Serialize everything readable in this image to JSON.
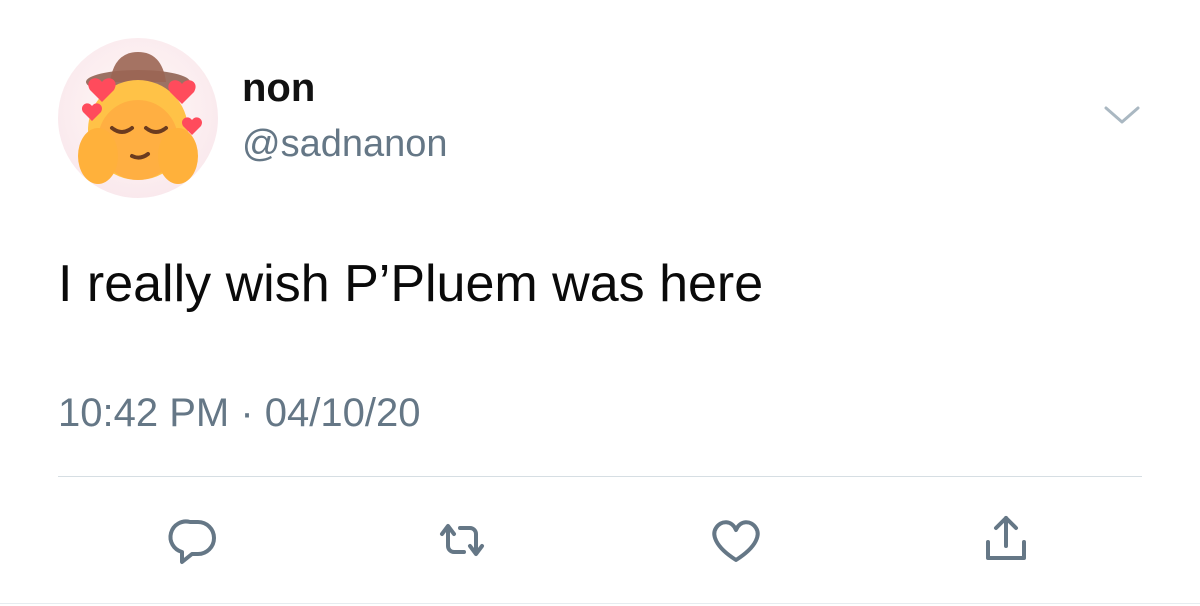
{
  "tweet": {
    "display_name": "non",
    "username": "@sadnanon",
    "text": "I really wish P’Pluem was here",
    "timestamp": "10:42 PM · 04/10/20"
  },
  "icons": {
    "avatar": "smiling-emoji-with-hearts-and-cowboy-hat",
    "caret": "chevron-down-icon",
    "reply": "reply-icon",
    "retweet": "retweet-icon",
    "like": "heart-icon",
    "share": "share-icon"
  },
  "colors": {
    "secondary_text": "#657786",
    "icon": "#657786",
    "divider": "#d6dee3"
  }
}
